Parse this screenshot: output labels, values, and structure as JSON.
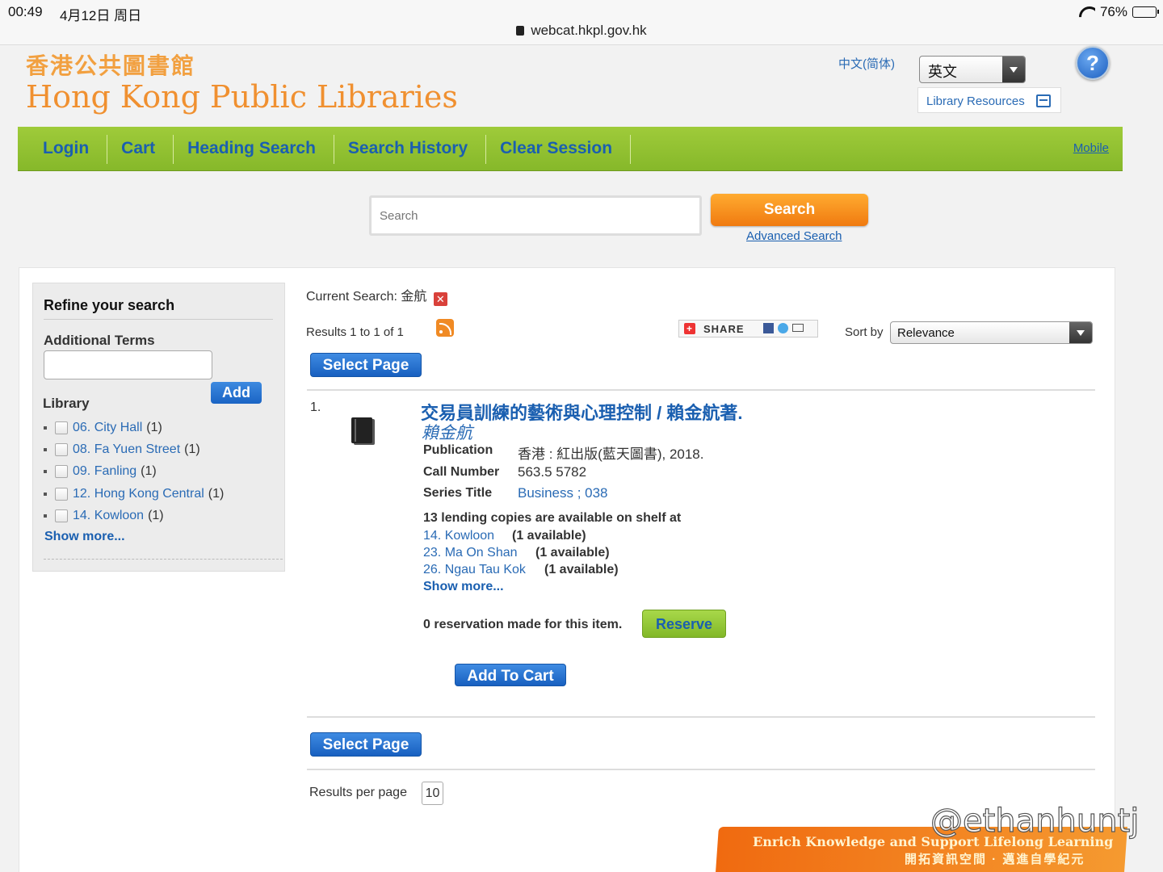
{
  "status_bar": {
    "time": "00:49",
    "date": "4月12日 周日",
    "url": "webcat.hkpl.gov.hk",
    "battery": "76%",
    "battery_level": 0.76
  },
  "header": {
    "logo_zh": "香港公共圖書館",
    "logo_en": "Hong Kong Public Libraries",
    "lang_link": "中文(简体)",
    "lang_selected": "英文",
    "help": "?",
    "library_resources": "Library Resources"
  },
  "nav": {
    "items": [
      "Login",
      "Cart",
      "Heading Search",
      "Search History",
      "Clear Session"
    ],
    "mobile": "Mobile"
  },
  "search": {
    "placeholder": "Search",
    "button": "Search",
    "advanced": "Advanced Search"
  },
  "refine": {
    "title": "Refine your search",
    "additional_terms": "Additional Terms",
    "add_button": "Add",
    "library_label": "Library",
    "libraries": [
      {
        "name": "06. City Hall",
        "count": "(1)"
      },
      {
        "name": "08. Fa Yuen Street",
        "count": "(1)"
      },
      {
        "name": "09. Fanling",
        "count": "(1)"
      },
      {
        "name": "12. Hong Kong Central",
        "count": "(1)"
      },
      {
        "name": "14. Kowloon",
        "count": "(1)"
      }
    ],
    "show_more": "Show more..."
  },
  "results": {
    "current_search_label": "Current Search:",
    "current_search_term": "金航",
    "count_text": "Results 1 to 1 of 1",
    "share": "SHARE",
    "sort_label": "Sort by",
    "sort_value": "Relevance",
    "select_page": "Select Page",
    "items": [
      {
        "num": "1.",
        "title": "交易員訓練的藝術與心理控制 / 賴金航著.",
        "author": "賴金航",
        "publication_label": "Publication",
        "publication": "香港 : 紅出版(藍天圖書), 2018.",
        "call_number_label": "Call Number",
        "call_number": "563.5 5782",
        "series_label": "Series Title",
        "series": "Business ; 038",
        "availability_head": "13 lending copies are available on shelf at",
        "availability": [
          {
            "library": "14. Kowloon",
            "count": "(1 available)"
          },
          {
            "library": "23. Ma On Shan",
            "count": "(1 available)"
          },
          {
            "library": "26. Ngau Tau Kok",
            "count": "(1 available)"
          }
        ],
        "show_more": "Show more...",
        "reservation_text": "0 reservation made for this item.",
        "reserve_button": "Reserve",
        "cart_button": "Add To Cart"
      }
    ],
    "per_page_label": "Results per page",
    "per_page_value": "10"
  },
  "banner": {
    "en": "Enrich Knowledge and Support Lifelong Learning",
    "zh": "開拓資訊空間 · 邁進自學紀元"
  },
  "watermark": "@ethanhuntj"
}
